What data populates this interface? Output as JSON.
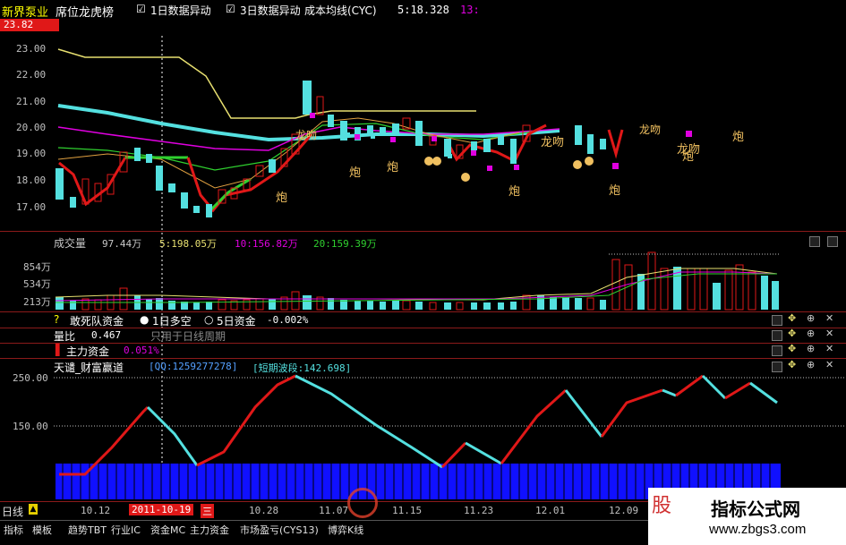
{
  "header": {
    "stock_name": "新界泵业",
    "tab_rank": "席位龙虎榜",
    "check1": "1日数据异动",
    "check2": "3日数据异动",
    "indicator_name": "成本均线(CYC)",
    "time": "5:18.328",
    "extra": "13:"
  },
  "price_pane": {
    "current_price": "23.82",
    "y_ticks": [
      "23.00",
      "22.00",
      "21.00",
      "20.00",
      "19.00",
      "18.00",
      "17.00"
    ],
    "markers": [
      "炮",
      "炮",
      "炮",
      "炮",
      "炮",
      "龙吻",
      "龙吻",
      "龙吻",
      "龙吻",
      "炮",
      "炮"
    ]
  },
  "volume_pane": {
    "title": "成交量",
    "vol": "97.44万",
    "ma5": "5:198.05万",
    "ma10": "10:156.82万",
    "ma20": "20:159.39万",
    "y_ticks": [
      "854万",
      "534万",
      "213万"
    ]
  },
  "indicator_rows": [
    {
      "name": "敢死队资金",
      "opt1": "1日多空",
      "opt2": "5日资金",
      "value": "-0.002%"
    },
    {
      "name": "量比",
      "value": "0.467",
      "note": "只用于日线周期"
    },
    {
      "name": "主力资金",
      "value": "0.051%"
    }
  ],
  "wealth_pane": {
    "title": "天谴_财富赢道",
    "qq": "[QQ:1259277278]",
    "wave": "[短期波段:142.698]",
    "y_ticks": [
      "250.00",
      "150.00"
    ]
  },
  "x_axis": {
    "period_label": "日线",
    "selected_date": "2011-10-19",
    "selected_day": "三",
    "dates": [
      "10.12",
      "10.28",
      "11.07",
      "11.15",
      "11.23",
      "12.01",
      "12.09"
    ]
  },
  "bottom_tabs": [
    "指标",
    "模板",
    "趋势TBT",
    "行业IC",
    "资金MC",
    "主力资金",
    "市场盈亏(CYS13)",
    "博弈K线"
  ],
  "watermark": {
    "brand": "股",
    "site_title": "指标公式网",
    "site_url": "www.zbgs3.com"
  },
  "colors": {
    "up": "#e01818",
    "down": "#54e0e0",
    "yellow": "#e8e070",
    "magenta": "#e000e0",
    "grid": "#8b1a1a",
    "blue": "#1010ff"
  }
}
